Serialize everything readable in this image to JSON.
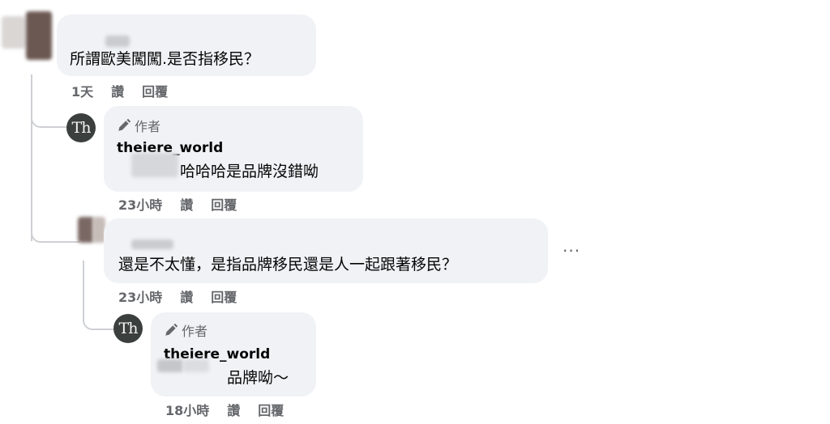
{
  "comments": [
    {
      "text": "所謂歐美闖闖.是否指移民？",
      "time": "1天",
      "like": "讚",
      "reply": "回覆"
    },
    {
      "badge": "作者",
      "author": "theiere_world",
      "text": "哈哈哈是品牌沒錯呦",
      "time": "23小時",
      "like": "讚",
      "reply": "回覆",
      "avatar_text": "Th"
    },
    {
      "text": "還是不太懂，是指品牌移民還是人一起跟著移民？",
      "time": "23小時",
      "like": "讚",
      "reply": "回覆",
      "more": "···"
    },
    {
      "badge": "作者",
      "author": "theiere_world",
      "text": "品牌呦～",
      "time": "18小時",
      "like": "讚",
      "reply": "回覆",
      "avatar_text": "Th"
    }
  ],
  "icons": {
    "author_badge": "pencil-icon"
  }
}
